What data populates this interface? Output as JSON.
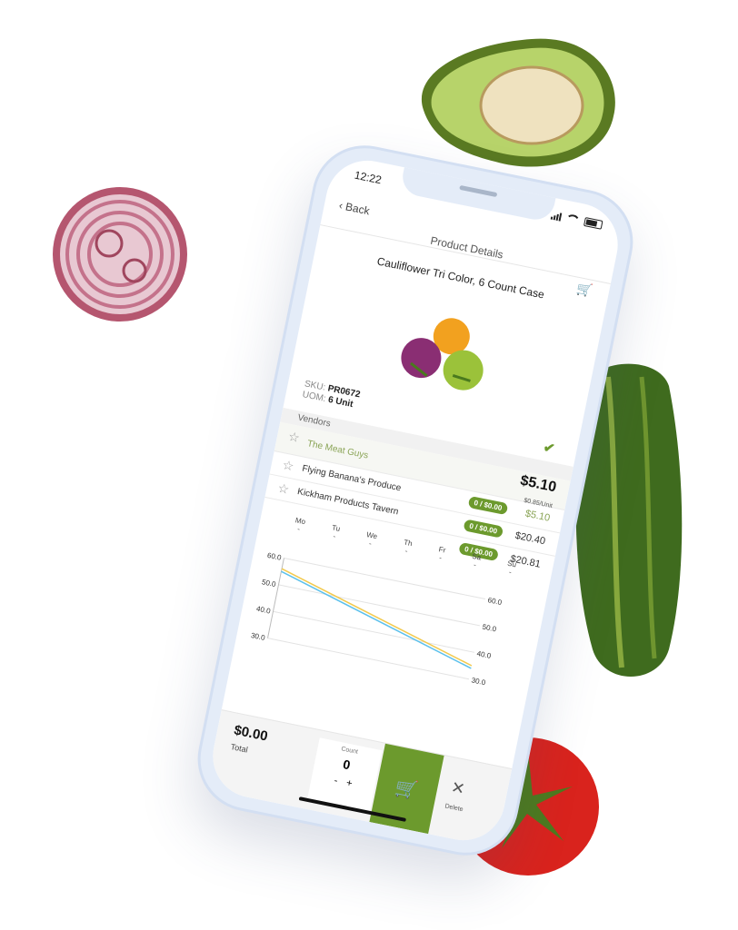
{
  "status": {
    "time": "12:22"
  },
  "nav": {
    "back_label": "Back",
    "title": "Product Details"
  },
  "product": {
    "name": "Cauliflower Tri Color, 6 Count Case",
    "sku_label": "SKU:",
    "sku": "PR0672",
    "uom_label": "UOM:",
    "uom": "6 Unit"
  },
  "vendors": {
    "heading": "Vendors",
    "items": [
      {
        "name": "The Meat Guys",
        "price": "$5.10",
        "unit_price": "$0.85/Unit"
      },
      {
        "name": "Flying Banana's Produce",
        "order": "0 / $0.00",
        "price": "$5.10"
      },
      {
        "name": "Kickham Products Tavern",
        "order": "0 / $0.00",
        "price": "$20.40"
      },
      {
        "order": "0 / $0.00",
        "price": "$20.81"
      }
    ]
  },
  "days": [
    {
      "label": "Mo",
      "value": "-"
    },
    {
      "label": "Tu",
      "value": "-"
    },
    {
      "label": "We",
      "value": "-"
    },
    {
      "label": "Th",
      "value": "-"
    },
    {
      "label": "Fr",
      "value": "-"
    },
    {
      "label": "Sa",
      "value": "-"
    },
    {
      "label": "Su",
      "value": "-"
    }
  ],
  "chart_data": {
    "type": "line",
    "left_ticks": [
      "60.0",
      "50.0",
      "40.0",
      "30.0"
    ],
    "right_ticks": [
      "60.0",
      "50.0",
      "40.0",
      "30.0"
    ],
    "series": [
      {
        "color": "#f2c94c",
        "values": [
          56,
          35
        ]
      },
      {
        "color": "#5bc0eb",
        "values": [
          55,
          34
        ]
      }
    ],
    "ylim": [
      30,
      60
    ]
  },
  "footer": {
    "total_value": "$0.00",
    "total_label": "Total",
    "count_label": "Count",
    "count_value": "0",
    "minus": "-",
    "plus": "+",
    "delete_label": "Delete"
  },
  "colors": {
    "accent": "#6c9a2d"
  }
}
